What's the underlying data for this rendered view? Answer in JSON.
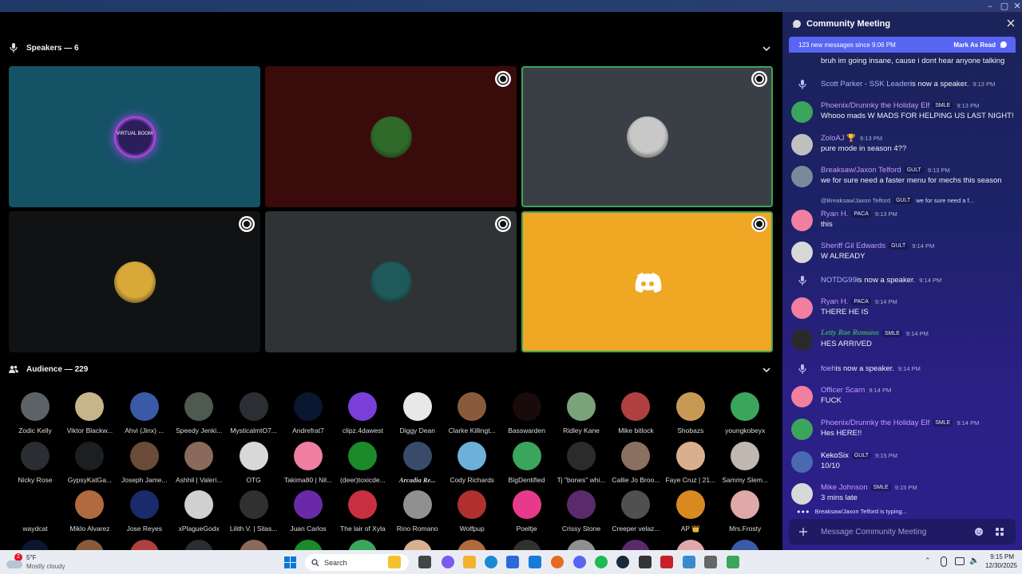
{
  "window": {
    "minimize": "–",
    "maximize": "▢",
    "close": "✕"
  },
  "speakers": {
    "header": "Speakers — 6"
  },
  "speaker_tiles": [
    {
      "bg": "#145266",
      "avatar_label": "VIRTUAL BOOM",
      "server_badge": false,
      "speaking": false
    },
    {
      "bg": "#3a0b0b",
      "avatar_label": "",
      "server_badge": true,
      "speaking": false
    },
    {
      "bg": "#3a3f45",
      "avatar_label": "",
      "server_badge": true,
      "speaking": true
    },
    {
      "bg": "#111214",
      "avatar_label": "",
      "server_badge": true,
      "speaking": false
    },
    {
      "bg": "#2f3335",
      "avatar_label": "",
      "server_badge": true,
      "speaking": false
    },
    {
      "bg": "#f0a724",
      "avatar_label": "",
      "server_badge": true,
      "speaking": true
    }
  ],
  "audience": {
    "header": "Audience — 229",
    "members": [
      "Zodic Kelly",
      "Viktor Blackw...",
      "Ahvi (Jinx) ...",
      "Speedy Jenki...",
      "MysticalmtO7...",
      "Andrefrat7",
      "clipz.4dawest",
      "Diggy Dean",
      "Clarke Killingt...",
      "Basswarden",
      "Ridley Kane",
      "Mike bitlock",
      "Shobazs",
      "youngkobeyx",
      "Nicky Rose",
      "GypsyKatGa...",
      "Joseph Jame...",
      "Ashhil | Valeri...",
      "OTG",
      "Takima80 | Nil...",
      "(deer)toxicde...",
      "Arcadia Re...",
      "Cody Richards",
      "BigDentified",
      "Tj \"bones\" whi...",
      "Callie Jo Broo...",
      "Faye Cruz | 21...",
      "Sammy Slem...",
      "waydcat",
      "Miklo Alvarez",
      "Jose Reyes",
      "xPlagueGodx",
      "Lilith V. | Silas...",
      "Juan Carlos",
      "The lair of Xyla",
      "Rino Romano",
      "Wolfpup",
      "Poeltje",
      "Crissy Stone",
      "Creeper velaz...",
      "AP 👑",
      "Mrs.Frosty"
    ],
    "colors": [
      "#5b6268",
      "#c8b48a",
      "#3a5aa8",
      "#4d5a4f",
      "#2b2f33",
      "#0b1730",
      "#7a3fd8",
      "#e8e8e8",
      "#8a5a3c",
      "#1a0b0b",
      "#7aa37a",
      "#b04040",
      "#c69a55",
      "#3ba55c",
      "#2a2d31",
      "#1c1f22",
      "#6b4a3a",
      "#8a6a5a",
      "#d8d8d8",
      "#ef7ea0",
      "#1a8a2a",
      "#3a4a6a",
      "#6fb0d8",
      "#3ba55c",
      "#2b2b2b",
      "#8a7060",
      "#d8b090",
      "#c0b8b0",
      "#000000",
      "#b06a40",
      "#1a2a6a",
      "#d0d0d0",
      "#303030",
      "#6a2aa8",
      "#c83040",
      "#909090",
      "#b03030",
      "#e83a8a",
      "#5a2a6a",
      "#505050",
      "#d88a20",
      "#e0a8a8"
    ]
  },
  "chat": {
    "title": "Community Meeting",
    "new_messages": "123 new messages since 9:06 PM",
    "mark_as_read": "Mark As Read",
    "messages": [
      {
        "type": "cont",
        "text": "bruh im going insane, cause i dont hear anyone talking"
      },
      {
        "type": "sys",
        "name": "Scott Parker - SSK Leader",
        "text": " is now a speaker.",
        "time": "9:13 PM"
      },
      {
        "type": "msg",
        "name": "Phoenix/Drunnky the Holiday Elf",
        "color": "#c79bff",
        "tag": "SMLE",
        "time": "9:13 PM",
        "text": "Whooo mads W MADS FOR HELPING US LAST NIGHT!",
        "av": "#3ba55c"
      },
      {
        "type": "msg",
        "name": "ZoloAJ 🏆",
        "color": "#c79bff",
        "tag": "",
        "time": "9:13 PM",
        "text": "pure mode in season 4??",
        "av": "#c0c0c0"
      },
      {
        "type": "msg",
        "name": "Breaksaw/Jaxon Telford",
        "color": "#c79bff",
        "tag": "GULT",
        "time": "9:13 PM",
        "text": "we for sure need a faster menu for mechs this season",
        "av": "#7a8a9a"
      },
      {
        "type": "reply",
        "text": "@Breaksaw/Jaxon Telford",
        "tag": "GULT",
        "rest": "we for sure need a f..."
      },
      {
        "type": "msg",
        "name": "Ryan H.",
        "color": "#c79bff",
        "tag": "PACA",
        "time": "9:13 PM",
        "text": "this",
        "av": "#f07fa0"
      },
      {
        "type": "msg",
        "name": "Sheriff Gil Edwards",
        "color": "#c79bff",
        "tag": "GULT",
        "time": "9:14 PM",
        "text": "W ALREADY",
        "av": "#d8d8d8"
      },
      {
        "type": "sys",
        "name": "NOTDG99",
        "text": " is now a speaker.",
        "time": "9:14 PM"
      },
      {
        "type": "msg",
        "name": "Ryan H.",
        "color": "#c79bff",
        "tag": "PACA",
        "time": "9:14 PM",
        "text": "THERE HE IS",
        "av": "#f07fa0"
      },
      {
        "type": "msg",
        "name": "Letty Rae Romano",
        "color": "#3ba55c",
        "tag": "SMLE",
        "time": "9:14 PM",
        "text": "HES ARRIVED",
        "av": "#2a2a2a"
      },
      {
        "type": "sys",
        "name": "foeh",
        "text": " is now a speaker.",
        "time": "9:14 PM"
      },
      {
        "type": "msg",
        "name": "Officer Scarn",
        "color": "#c79bff",
        "tag": "",
        "time": "9:14 PM",
        "text": "FUCK",
        "av": "#f07fa0"
      },
      {
        "type": "msg",
        "name": "Phoenix/Drunnky the Holiday Elf",
        "color": "#c79bff",
        "tag": "SMLE",
        "time": "9:14 PM",
        "text": "Hes HERE!!",
        "av": "#3ba55c"
      },
      {
        "type": "msg",
        "name": "KekoSix",
        "color": "#ffffff",
        "tag": "GULT",
        "time": "9:15 PM",
        "text": "10/10",
        "av": "#4a6ab0"
      },
      {
        "type": "msg",
        "name": "Mike Johnson",
        "color": "#c79bff",
        "tag": "SMLE",
        "time": "9:15 PM",
        "text": "3 mins late",
        "av": "#d8d8d8"
      }
    ],
    "typing": "Breaksaw/Jaxon Telford is typing...",
    "composer_placeholder": "Message Community Meeting"
  },
  "taskbar": {
    "weather_temp": "5°F",
    "weather_desc": "Mostly cloudy",
    "search": "Search",
    "time": "9:15 PM",
    "date": "12/30/2025",
    "notif_count": "2"
  }
}
